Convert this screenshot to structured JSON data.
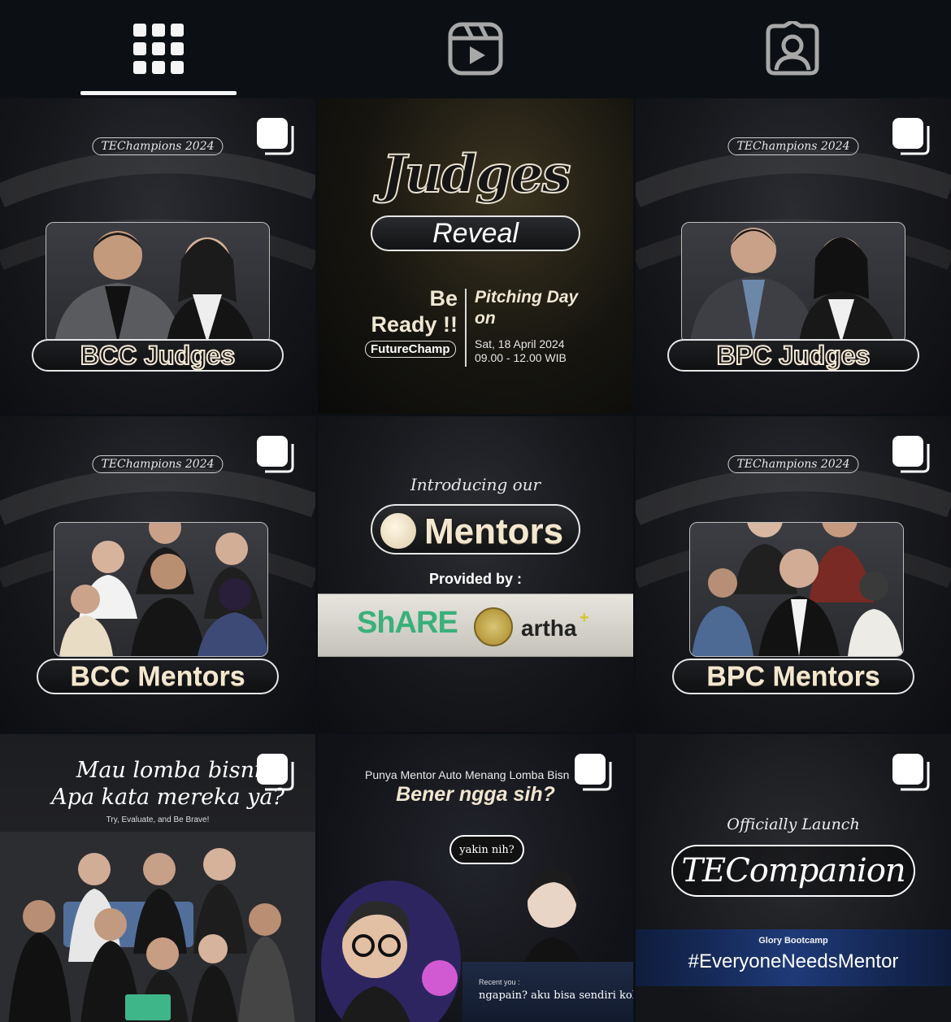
{
  "tabs": [
    {
      "name": "grid-icon",
      "active": true
    },
    {
      "name": "reels-icon",
      "active": false
    },
    {
      "name": "tagged-icon",
      "active": false
    }
  ],
  "posts": {
    "p1": {
      "pill": "TEChampions 2024",
      "title": "BCC Judges"
    },
    "p2": {
      "title": "Judges",
      "subtitle": "Reveal",
      "be": "Be",
      "ready": "Ready !!",
      "badge": "FutureChamp",
      "pitch1": "Pitching Day",
      "pitch2": "on",
      "date": "Sat, 18 April 2024",
      "time": "09.00 - 12.00 WIB"
    },
    "p3": {
      "pill": "TEChampions 2024",
      "title": "BPC Judges"
    },
    "p4": {
      "pill": "TEChampions 2024",
      "title": "BCC Mentors"
    },
    "p5": {
      "intro": "Introducing our",
      "title": "Mentors",
      "provided": "Provided by :",
      "sponsor1": "ShARE",
      "sponsor2": "artha",
      "sponsor2_plus": "+"
    },
    "p6": {
      "pill": "TEChampions 2024",
      "title": "BPC Mentors"
    },
    "p7": {
      "line1": "Mau lomba bisnis?",
      "line2": "Apa kata mereka ya?",
      "sub": "Try, Evaluate, and Be Brave!"
    },
    "p8": {
      "question": "Punya Mentor Auto Menang Lomba Bisn",
      "big": "Bener ngga sih?",
      "bubble": "yakin nih?",
      "recent_label": "Recent you :",
      "recent_text": "ngapain? aku bisa sendiri kok"
    },
    "p9": {
      "launch": "Officially Launch",
      "title": "TECompanion",
      "glory": "Glory Bootcamp",
      "hashtag": "#EveryoneNeedsMentor"
    }
  },
  "colors": {
    "background": "#0c1014",
    "cream": "#f3e7cf",
    "accent_white": "#f5f5f5"
  }
}
